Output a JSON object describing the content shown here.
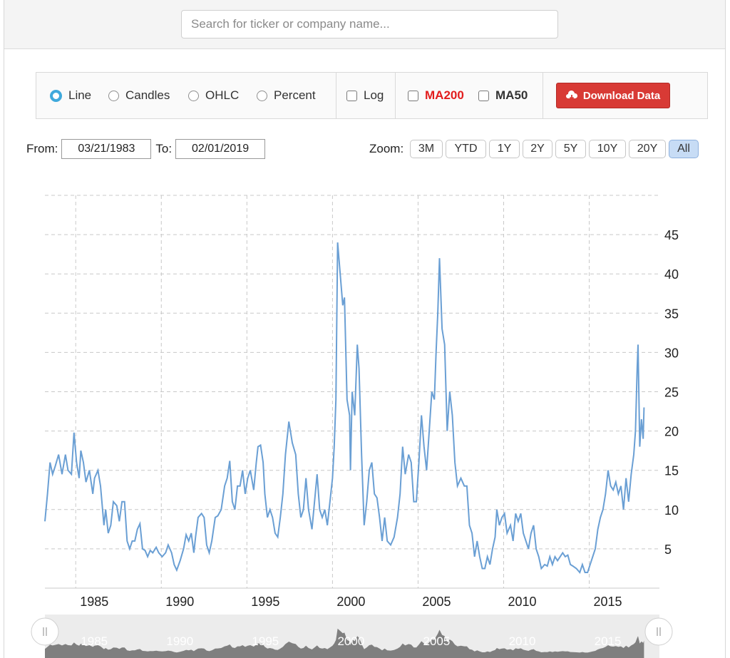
{
  "search": {
    "placeholder": "Search for ticker or company name..."
  },
  "controls": {
    "line_label": "Line",
    "candles_label": "Candles",
    "ohlc_label": "OHLC",
    "percent_label": "Percent",
    "log_label": "Log",
    "ma200_label": "MA200",
    "ma50_label": "MA50",
    "download_label": "Download Data",
    "selected_mode": "Line",
    "accent_color": "#3fa9dc",
    "ma200_color": "#e21d1d",
    "download_color": "#d83a35",
    "download_icon": "cloud-download-icon"
  },
  "range": {
    "from_label": "From:",
    "from_value": "03/21/1983",
    "to_label": "To:",
    "to_value": "02/01/2019"
  },
  "zoom": {
    "label": "Zoom:",
    "buttons": [
      "3M",
      "YTD",
      "1Y",
      "2Y",
      "5Y",
      "10Y",
      "20Y",
      "All"
    ],
    "active": "All"
  },
  "chart_data": {
    "type": "line",
    "title": "",
    "xlabel": "",
    "ylabel": "",
    "xlim": [
      1983.2,
      2019.1
    ],
    "ylim": [
      0,
      50
    ],
    "yticks": [
      5,
      10,
      15,
      20,
      25,
      30,
      35,
      40,
      45
    ],
    "xticks": [
      1985,
      1990,
      1995,
      2000,
      2005,
      2010,
      2015
    ],
    "grid": true,
    "line_color": "#6a9fd4",
    "series": [
      {
        "points": [
          [
            1983.2,
            8.5
          ],
          [
            1983.35,
            12
          ],
          [
            1983.5,
            16
          ],
          [
            1983.65,
            14.5
          ],
          [
            1983.8,
            15.5
          ],
          [
            1984.0,
            17
          ],
          [
            1984.2,
            14.5
          ],
          [
            1984.4,
            17
          ],
          [
            1984.55,
            15
          ],
          [
            1984.75,
            14.5
          ],
          [
            1984.9,
            19.8
          ],
          [
            1985.05,
            16
          ],
          [
            1985.2,
            14
          ],
          [
            1985.3,
            17.5
          ],
          [
            1985.45,
            16
          ],
          [
            1985.6,
            13.5
          ],
          [
            1985.8,
            15
          ],
          [
            1986.0,
            12
          ],
          [
            1986.1,
            14
          ],
          [
            1986.3,
            15
          ],
          [
            1986.45,
            13
          ],
          [
            1986.65,
            8
          ],
          [
            1986.75,
            10
          ],
          [
            1986.9,
            7
          ],
          [
            1987.05,
            8
          ],
          [
            1987.2,
            11
          ],
          [
            1987.4,
            10.5
          ],
          [
            1987.55,
            8.5
          ],
          [
            1987.7,
            11
          ],
          [
            1987.85,
            11
          ],
          [
            1988.0,
            6
          ],
          [
            1988.15,
            5
          ],
          [
            1988.3,
            6
          ],
          [
            1988.45,
            6
          ],
          [
            1988.6,
            7.5
          ],
          [
            1988.75,
            8.2
          ],
          [
            1988.9,
            5
          ],
          [
            1989.05,
            4.8
          ],
          [
            1989.2,
            4
          ],
          [
            1989.35,
            4.8
          ],
          [
            1989.5,
            4.5
          ],
          [
            1989.7,
            5.2
          ],
          [
            1989.85,
            4.5
          ],
          [
            1990.05,
            4
          ],
          [
            1990.25,
            4.5
          ],
          [
            1990.4,
            5.5
          ],
          [
            1990.6,
            4.5
          ],
          [
            1990.75,
            3
          ],
          [
            1990.9,
            2.3
          ],
          [
            1991.1,
            3.5
          ],
          [
            1991.3,
            5
          ],
          [
            1991.45,
            6.8
          ],
          [
            1991.6,
            6
          ],
          [
            1991.75,
            7
          ],
          [
            1991.9,
            4.5
          ],
          [
            1992.0,
            6.5
          ],
          [
            1992.15,
            9
          ],
          [
            1992.35,
            9.5
          ],
          [
            1992.5,
            9
          ],
          [
            1992.65,
            5.5
          ],
          [
            1992.8,
            4.5
          ],
          [
            1992.95,
            6
          ],
          [
            1993.15,
            9
          ],
          [
            1993.3,
            9.2
          ],
          [
            1993.5,
            10
          ],
          [
            1993.7,
            13
          ],
          [
            1993.85,
            14
          ],
          [
            1994.0,
            16.2
          ],
          [
            1994.15,
            11
          ],
          [
            1994.3,
            10
          ],
          [
            1994.45,
            13
          ],
          [
            1994.6,
            13
          ],
          [
            1994.75,
            15
          ],
          [
            1994.9,
            12
          ],
          [
            1995.05,
            14
          ],
          [
            1995.2,
            15
          ],
          [
            1995.4,
            12.5
          ],
          [
            1995.55,
            16
          ],
          [
            1995.65,
            18
          ],
          [
            1995.8,
            18.2
          ],
          [
            1995.95,
            16
          ],
          [
            1996.05,
            12
          ],
          [
            1996.2,
            9
          ],
          [
            1996.35,
            10
          ],
          [
            1996.5,
            9
          ],
          [
            1996.65,
            7
          ],
          [
            1996.8,
            6.5
          ],
          [
            1996.95,
            9
          ],
          [
            1997.1,
            12
          ],
          [
            1997.25,
            17
          ],
          [
            1997.45,
            21.2
          ],
          [
            1997.65,
            18.5
          ],
          [
            1997.85,
            17
          ],
          [
            1998.0,
            12
          ],
          [
            1998.15,
            9
          ],
          [
            1998.3,
            10
          ],
          [
            1998.45,
            14
          ],
          [
            1998.6,
            10
          ],
          [
            1998.8,
            7.5
          ],
          [
            1998.95,
            11
          ],
          [
            1999.1,
            14.5
          ],
          [
            1999.25,
            10
          ],
          [
            1999.4,
            9
          ],
          [
            1999.55,
            10
          ],
          [
            1999.7,
            8
          ],
          [
            1999.85,
            11
          ],
          [
            2000.0,
            14
          ],
          [
            2000.1,
            18
          ],
          [
            2000.2,
            24
          ],
          [
            2000.3,
            44
          ],
          [
            2000.45,
            40
          ],
          [
            2000.6,
            36
          ],
          [
            2000.7,
            37
          ],
          [
            2000.85,
            24
          ],
          [
            2001.0,
            22
          ],
          [
            2001.05,
            15
          ],
          [
            2001.15,
            25
          ],
          [
            2001.3,
            22
          ],
          [
            2001.45,
            31
          ],
          [
            2001.55,
            28
          ],
          [
            2001.7,
            17
          ],
          [
            2001.85,
            8
          ],
          [
            2002.0,
            11
          ],
          [
            2002.15,
            15
          ],
          [
            2002.3,
            16
          ],
          [
            2002.45,
            12
          ],
          [
            2002.6,
            11.5
          ],
          [
            2002.75,
            9
          ],
          [
            2002.9,
            6
          ],
          [
            2003.05,
            9
          ],
          [
            2003.2,
            6
          ],
          [
            2003.4,
            5.5
          ],
          [
            2003.6,
            6.5
          ],
          [
            2003.8,
            9
          ],
          [
            2003.95,
            12
          ],
          [
            2004.1,
            18
          ],
          [
            2004.25,
            14.5
          ],
          [
            2004.45,
            17
          ],
          [
            2004.6,
            16
          ],
          [
            2004.75,
            11
          ],
          [
            2004.9,
            11
          ],
          [
            2005.05,
            16
          ],
          [
            2005.2,
            22
          ],
          [
            2005.35,
            18
          ],
          [
            2005.5,
            15
          ],
          [
            2005.65,
            20
          ],
          [
            2005.8,
            25
          ],
          [
            2005.95,
            24
          ],
          [
            2006.05,
            30
          ],
          [
            2006.15,
            35
          ],
          [
            2006.25,
            42
          ],
          [
            2006.4,
            33
          ],
          [
            2006.55,
            31
          ],
          [
            2006.7,
            20
          ],
          [
            2006.85,
            25
          ],
          [
            2007.0,
            22
          ],
          [
            2007.15,
            16
          ],
          [
            2007.3,
            13
          ],
          [
            2007.5,
            14
          ],
          [
            2007.7,
            13
          ],
          [
            2007.85,
            13
          ],
          [
            2008.0,
            8
          ],
          [
            2008.15,
            7
          ],
          [
            2008.3,
            4
          ],
          [
            2008.45,
            6
          ],
          [
            2008.6,
            4
          ],
          [
            2008.75,
            2.5
          ],
          [
            2008.9,
            2.5
          ],
          [
            2009.05,
            4
          ],
          [
            2009.2,
            3
          ],
          [
            2009.35,
            5
          ],
          [
            2009.5,
            6.5
          ],
          [
            2009.6,
            10
          ],
          [
            2009.75,
            8
          ],
          [
            2009.9,
            9
          ],
          [
            2010.05,
            9.5
          ],
          [
            2010.2,
            7
          ],
          [
            2010.4,
            8
          ],
          [
            2010.55,
            6
          ],
          [
            2010.7,
            9.5
          ],
          [
            2010.85,
            8.5
          ],
          [
            2011.0,
            9.5
          ],
          [
            2011.15,
            7
          ],
          [
            2011.3,
            6
          ],
          [
            2011.45,
            5
          ],
          [
            2011.6,
            7
          ],
          [
            2011.75,
            8
          ],
          [
            2011.9,
            5
          ],
          [
            2012.05,
            4
          ],
          [
            2012.2,
            2.5
          ],
          [
            2012.4,
            3
          ],
          [
            2012.55,
            2.8
          ],
          [
            2012.7,
            4
          ],
          [
            2012.85,
            3
          ],
          [
            2013.0,
            4
          ],
          [
            2013.15,
            3.5
          ],
          [
            2013.3,
            4
          ],
          [
            2013.45,
            4.5
          ],
          [
            2013.6,
            4
          ],
          [
            2013.75,
            4.2
          ],
          [
            2013.9,
            3
          ],
          [
            2014.05,
            2.8
          ],
          [
            2014.25,
            2.5
          ],
          [
            2014.45,
            2
          ],
          [
            2014.6,
            3
          ],
          [
            2014.75,
            2
          ],
          [
            2014.9,
            2
          ],
          [
            2015.05,
            3
          ],
          [
            2015.2,
            4
          ],
          [
            2015.35,
            5
          ],
          [
            2015.5,
            7.5
          ],
          [
            2015.65,
            9
          ],
          [
            2015.8,
            10
          ],
          [
            2015.95,
            12
          ],
          [
            2016.1,
            15
          ],
          [
            2016.25,
            13
          ],
          [
            2016.4,
            12.5
          ],
          [
            2016.55,
            13.5
          ],
          [
            2016.7,
            12
          ],
          [
            2016.85,
            13
          ],
          [
            2017.0,
            10
          ],
          [
            2017.15,
            14
          ],
          [
            2017.3,
            11
          ],
          [
            2017.45,
            14.5
          ],
          [
            2017.6,
            17
          ],
          [
            2017.7,
            20
          ],
          [
            2017.8,
            28
          ],
          [
            2017.85,
            31
          ],
          [
            2017.95,
            18
          ],
          [
            2018.05,
            21.5
          ],
          [
            2018.15,
            19
          ],
          [
            2018.2,
            23
          ]
        ]
      }
    ]
  },
  "navigator": {
    "years": [
      "1985",
      "1990",
      "1995",
      "2000",
      "2005",
      "2010",
      "2015"
    ],
    "handle_left_icon": "drag-handle-icon",
    "handle_right_icon": "drag-handle-icon"
  }
}
